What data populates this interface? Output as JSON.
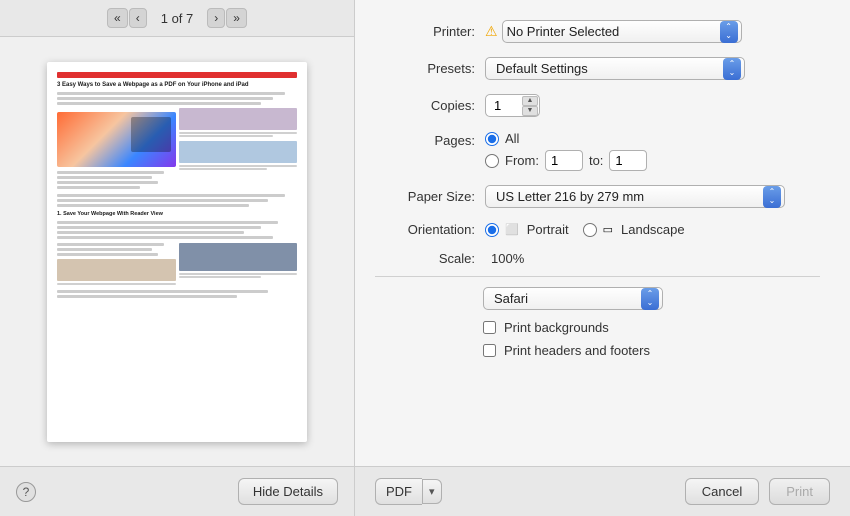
{
  "left": {
    "page_indicator": "1 of 7",
    "nav": {
      "first_label": "«",
      "prev_label": "‹",
      "next_label": "›",
      "last_label": "»"
    },
    "preview_title": "3 Easy Ways to Save a Webpage as a PDF on Your iPhone and iPad",
    "bottom": {
      "help_label": "?",
      "hide_details_label": "Hide Details"
    }
  },
  "right": {
    "labels": {
      "printer": "Printer:",
      "presets": "Presets:",
      "copies": "Copies:",
      "pages": "Pages:",
      "paper_size": "Paper Size:",
      "orientation": "Orientation:",
      "scale": "Scale:"
    },
    "printer": {
      "value": "No Printer Selected",
      "warning": true
    },
    "presets": {
      "value": "Default Settings"
    },
    "copies": {
      "value": "1"
    },
    "pages": {
      "all_label": "All",
      "from_label": "From:",
      "from_value": "1",
      "to_label": "to:",
      "to_value": "1"
    },
    "paper_size": {
      "value": "US Letter",
      "detail": "216 by 279 mm"
    },
    "orientation": {
      "portrait_label": "Portrait",
      "landscape_label": "Landscape"
    },
    "scale": {
      "value": "100%"
    },
    "safari_section": {
      "dropdown_value": "Safari",
      "checkboxes": [
        {
          "label": "Print backgrounds",
          "checked": false
        },
        {
          "label": "Print headers and footers",
          "checked": false
        }
      ]
    },
    "actions": {
      "pdf_label": "PDF",
      "cancel_label": "Cancel",
      "print_label": "Print"
    }
  }
}
